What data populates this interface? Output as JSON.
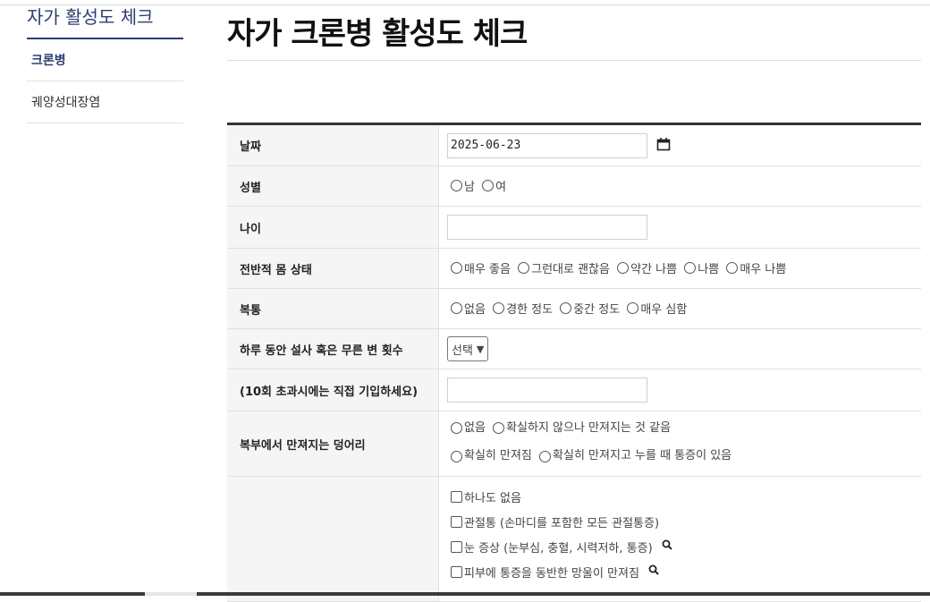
{
  "sidebar": {
    "title": "자가 활성도 체크",
    "items": [
      {
        "label": "크론병"
      },
      {
        "label": "궤양성대장염"
      }
    ]
  },
  "page": {
    "title": "자가 크론병 활성도 체크"
  },
  "form": {
    "date": {
      "label": "날짜",
      "value": "2025-06-23",
      "icon": "calendar-icon"
    },
    "gender": {
      "label": "성별",
      "options": [
        "남",
        "여"
      ]
    },
    "age": {
      "label": "나이",
      "value": ""
    },
    "condition": {
      "label": "전반적 몸 상태",
      "options": [
        "매우 좋음",
        "그런대로 괜찮음",
        "약간 나쁨",
        "나쁨",
        "매우 나쁨"
      ]
    },
    "pain": {
      "label": "복통",
      "options": [
        "없음",
        "경한 정도",
        "중간 정도",
        "매우 심함"
      ]
    },
    "stool": {
      "label": "하루 동안 설사 혹은 무른 변 횟수",
      "selected": "선택"
    },
    "stool_direct": {
      "label": "(10회 초과시에는 직접 기입하세요)",
      "value": ""
    },
    "mass": {
      "label": "복부에서 만져지는 덩어리",
      "options_line1": [
        "없음",
        "확실하지 않으나 만져지는 것 같음"
      ],
      "options_line2": [
        "확실히 만져짐",
        "확실히 만져지고 누를 때 통증이 있음"
      ]
    },
    "symptoms": {
      "options": [
        "하나도 없음",
        "관절통 (손마디를 포함한 모든 관절통증)",
        "눈 증상 (눈부심, 충혈, 시력저하, 통증)",
        "피부에 통증을 동반한 망울이 만져짐"
      ]
    }
  }
}
